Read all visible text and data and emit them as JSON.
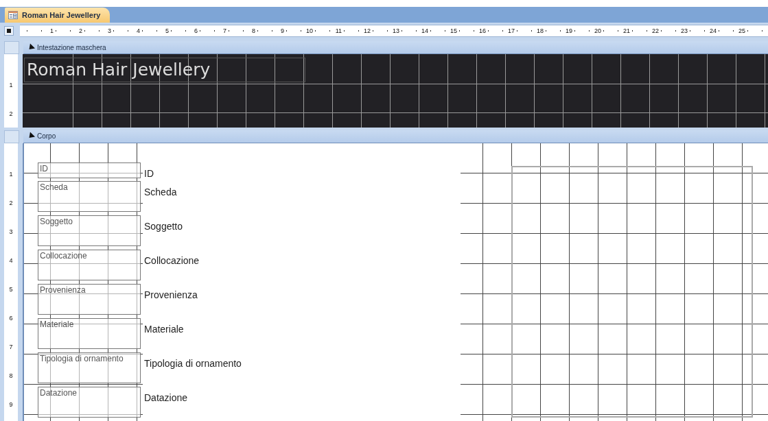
{
  "tab": {
    "title": "Roman Hair Jewellery",
    "selected": true
  },
  "ruler": {
    "marks": [
      "1",
      "2",
      "3",
      "4",
      "5",
      "6",
      "7",
      "8",
      "9",
      "10",
      "11",
      "12",
      "13",
      "14",
      "15",
      "16",
      "17",
      "18",
      "19",
      "20",
      "21",
      "22",
      "23",
      "24",
      "25"
    ]
  },
  "sections": [
    {
      "kind": "header",
      "title": "Intestazione maschera",
      "vertical_marks": [
        "1",
        "2"
      ],
      "heading": "Roman Hair Jewellery"
    },
    {
      "kind": "detail",
      "title": "Corpo",
      "vertical_marks": [
        "1",
        "2",
        "3",
        "4",
        "5",
        "6",
        "7",
        "8",
        "9"
      ],
      "fields": [
        {
          "label": "ID",
          "control": "ID"
        },
        {
          "label": "Scheda",
          "control": "Scheda"
        },
        {
          "label": "Soggetto",
          "control": "Soggetto"
        },
        {
          "label": "Collocazione",
          "control": "Collocazione"
        },
        {
          "label": "Provenienza",
          "control": "Provenienza"
        },
        {
          "label": "Materiale",
          "control": "Materiale"
        },
        {
          "label": "Tipologia di ornamento",
          "control": "Tipologia di ornamento"
        },
        {
          "label": "Datazione",
          "control": "Datazione"
        }
      ],
      "image_frame": {
        "kind": "picture"
      }
    }
  ]
}
